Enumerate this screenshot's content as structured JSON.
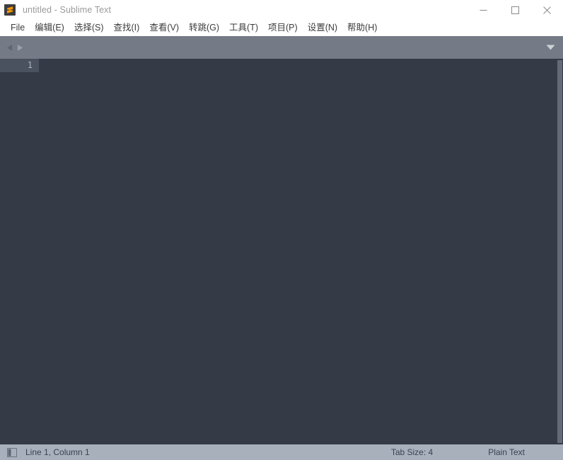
{
  "window": {
    "title": "untitled - Sublime Text",
    "logo_icon": "sublime-text-logo",
    "controls": [
      {
        "name": "minimize",
        "icon": "minimize-icon"
      },
      {
        "name": "maximize",
        "icon": "maximize-icon"
      },
      {
        "name": "close",
        "icon": "close-icon"
      }
    ]
  },
  "menubar": {
    "items": [
      {
        "label": "File"
      },
      {
        "label": "编辑(E)"
      },
      {
        "label": "选择(S)"
      },
      {
        "label": "查找(I)"
      },
      {
        "label": "查看(V)"
      },
      {
        "label": "转跳(G)"
      },
      {
        "label": "工具(T)"
      },
      {
        "label": "项目(P)"
      },
      {
        "label": "设置(N)"
      },
      {
        "label": "帮助(H)"
      }
    ]
  },
  "tabbar": {
    "prev_icon": "arrow-left-icon",
    "next_icon": "arrow-right-icon",
    "menu_icon": "chevron-down-icon"
  },
  "editor": {
    "line_numbers": [
      "1"
    ],
    "content": "",
    "background_color": "#343b46",
    "gutter_active_color": "#4a5260"
  },
  "statusbar": {
    "sidebar_icon": "sidebar-toggle-icon",
    "position": "Line 1, Column 1",
    "tab_size": "Tab Size: 4",
    "syntax": "Plain Text"
  }
}
